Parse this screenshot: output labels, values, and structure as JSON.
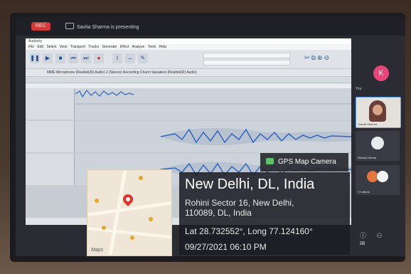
{
  "meeting": {
    "rec_label": "REC",
    "presenting_text": "Savita Sharma is presenting"
  },
  "app": {
    "title": "Audacity",
    "menu": "File Edit Select View Transport Tracks Generate Effect Analyze Tools Help",
    "devices": "MME   Microphone (Realtek(R) Audio)   2 (Stereo) Recording Chann   Speakers (Realtek(R) Audio)"
  },
  "participants": {
    "self_initial": "K",
    "you_label": "You",
    "tiles": [
      {
        "name": "Savita Sharma"
      },
      {
        "name": "Nishant Verma"
      },
      {
        "name": "+2 others"
      }
    ]
  },
  "gps": {
    "badge": "GPS Map Camera",
    "city": "New Delhi, DL, India",
    "address_line1": "Rohini Sector 16, New Delhi,",
    "address_line2": "110089, DL, India",
    "coords": "Lat 28.732552°, Long 77.124160°",
    "datetime": "09/27/2021 06:10 PM",
    "map_logo": "Maps"
  },
  "colors": {
    "rec": "#d23a3a",
    "avatar": "#e8467a",
    "waveform": "#2f66c4",
    "pin": "#e0332c"
  }
}
